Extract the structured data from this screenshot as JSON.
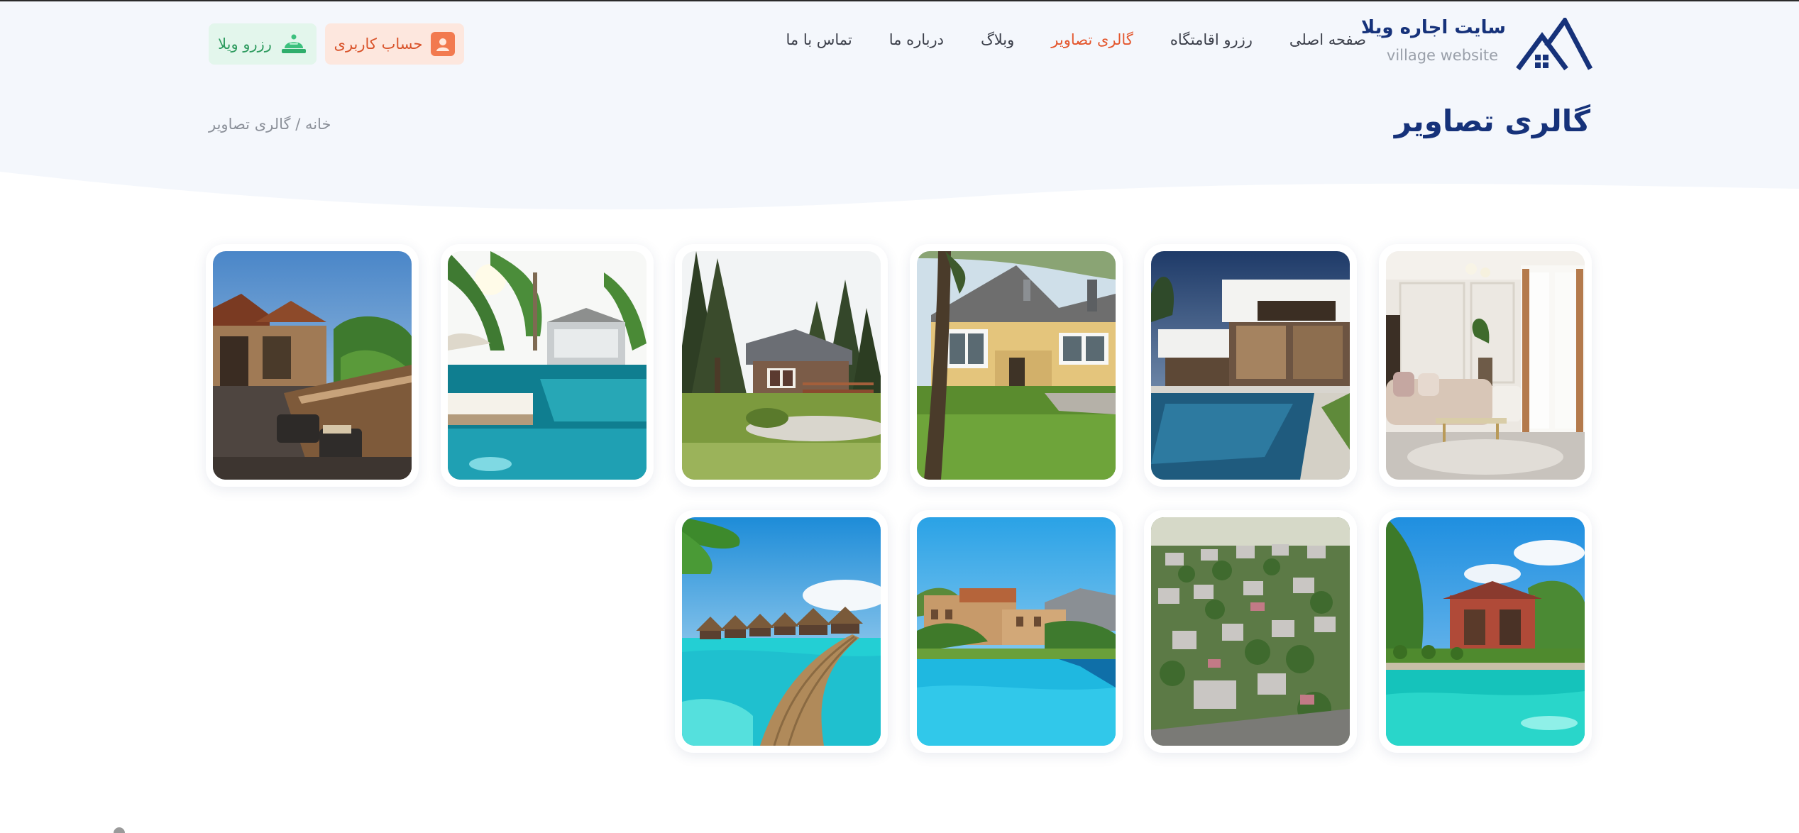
{
  "header": {
    "brand_title": "سایت اجاره ویلا",
    "brand_subtitle": "village website",
    "nav": [
      {
        "label": "صفحه اصلی",
        "active": false
      },
      {
        "label": "رزرو اقامتگاه",
        "active": false
      },
      {
        "label": "گالری تصاویر",
        "active": true
      },
      {
        "label": "وبلاگ",
        "active": false
      },
      {
        "label": "درباره ما",
        "active": false
      },
      {
        "label": "تماس با ما",
        "active": false
      }
    ],
    "account_button": "حساب کاربری",
    "reserve_button": "رزرو ویلا"
  },
  "page": {
    "title": "گالری تصاویر",
    "breadcrumb": "خانه / گالری تصاویر"
  },
  "gallery": {
    "images": [
      {
        "subject": "modern living room interior"
      },
      {
        "subject": "modern white villa with pool"
      },
      {
        "subject": "yellow wooden house with lawn"
      },
      {
        "subject": "cottage among pine trees"
      },
      {
        "subject": "resort pool with palm trees"
      },
      {
        "subject": "thai style villa with terrace"
      },
      {
        "subject": "villa with turquoise pool"
      },
      {
        "subject": "aerial view of village"
      },
      {
        "subject": "hotel buildings with pool"
      },
      {
        "subject": "overwater bungalows with pier"
      }
    ]
  },
  "colors": {
    "brand_navy": "#16327a",
    "accent_orange": "#e4572e",
    "account_bg": "#fde7de",
    "reserve_bg": "#e3f6ec",
    "reserve_text": "#2e9b5f",
    "hero_bg": "#f4f7fc"
  },
  "icons": {
    "logo": "house-roofs-logo",
    "account": "user-icon",
    "reserve": "bell-icon"
  }
}
